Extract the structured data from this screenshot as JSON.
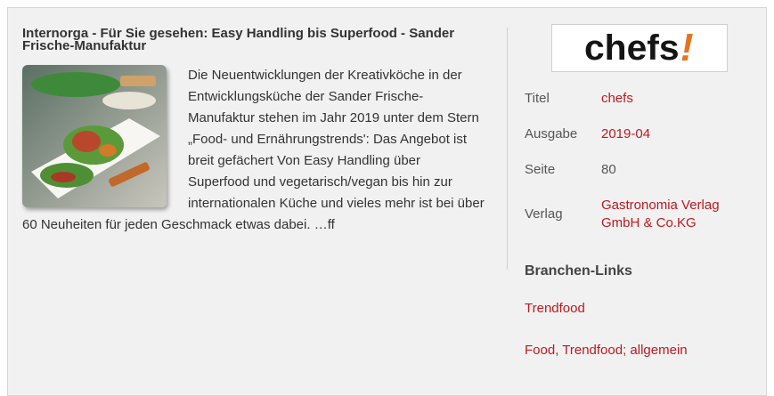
{
  "article": {
    "headline": "Internorga - Für Sie gesehen: Easy Handling bis Superfood - Sander Frische-Manufaktur",
    "teaser": "Die Neuentwicklungen der Kreativköche in der Entwicklungsküche der Sander Frische-Manufaktur stehen im Jahr 2019 unter dem Stern „Food- und Ernährungstrends': Das Angebot ist breit gefächert Von Easy Handling über Superfood und vegetarisch/vegan bis hin zur internationalen Küche und vieles mehr ist bei über 60 Neuheiten für jeden Geschmack etwas dabei. …ff"
  },
  "logo": {
    "word": "chefs",
    "mark": "!",
    "mark_color": "#e8731f"
  },
  "meta": [
    {
      "key": "Titel",
      "value": "chefs"
    },
    {
      "key": "Ausgabe",
      "value": "2019-04"
    },
    {
      "key": "Seite",
      "value": "80"
    },
    {
      "key": "Verlag",
      "value": "Gastronomia Verlag GmbH & Co.KG"
    }
  ],
  "branchen": {
    "title": "Branchen-Links",
    "links": [
      "Trendfood",
      "Food, Trendfood; allgemein"
    ]
  },
  "colors": {
    "accent": "#bb1a21",
    "panel": "#f1f1f1"
  }
}
